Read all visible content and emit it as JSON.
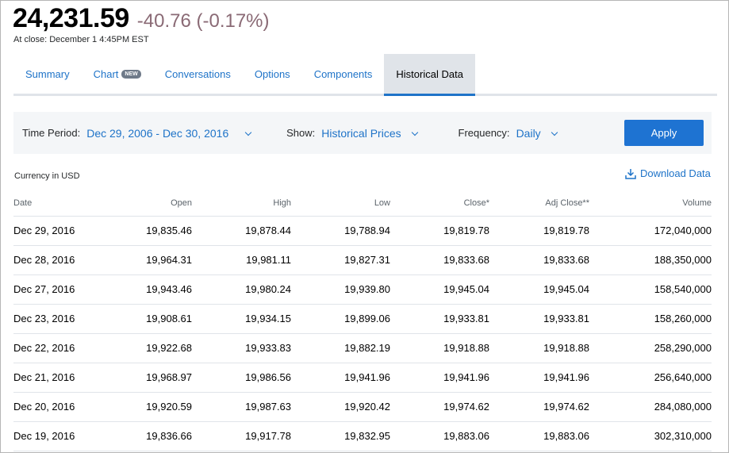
{
  "quote": {
    "price": "24,231.59",
    "change": "-40.76 (-0.17%)",
    "at_close": "At close: December 1 4:45PM EST"
  },
  "tabs": [
    {
      "label": "Summary",
      "badge": ""
    },
    {
      "label": "Chart",
      "badge": "NEW"
    },
    {
      "label": "Conversations",
      "badge": ""
    },
    {
      "label": "Options",
      "badge": ""
    },
    {
      "label": "Components",
      "badge": ""
    },
    {
      "label": "Historical Data",
      "badge": "",
      "active": true
    }
  ],
  "filters": {
    "time_period_label": "Time Period:",
    "time_period_value": "Dec 29, 2006 - Dec 30, 2016",
    "show_label": "Show:",
    "show_value": "Historical Prices",
    "frequency_label": "Frequency:",
    "frequency_value": "Daily",
    "apply_label": "Apply"
  },
  "currency": "Currency in USD",
  "download_label": "Download Data",
  "table": {
    "headers": [
      "Date",
      "Open",
      "High",
      "Low",
      "Close*",
      "Adj Close**",
      "Volume"
    ],
    "rows": [
      [
        "Dec 29, 2016",
        "19,835.46",
        "19,878.44",
        "19,788.94",
        "19,819.78",
        "19,819.78",
        "172,040,000"
      ],
      [
        "Dec 28, 2016",
        "19,964.31",
        "19,981.11",
        "19,827.31",
        "19,833.68",
        "19,833.68",
        "188,350,000"
      ],
      [
        "Dec 27, 2016",
        "19,943.46",
        "19,980.24",
        "19,939.80",
        "19,945.04",
        "19,945.04",
        "158,540,000"
      ],
      [
        "Dec 23, 2016",
        "19,908.61",
        "19,934.15",
        "19,899.06",
        "19,933.81",
        "19,933.81",
        "158,260,000"
      ],
      [
        "Dec 22, 2016",
        "19,922.68",
        "19,933.83",
        "19,882.19",
        "19,918.88",
        "19,918.88",
        "258,290,000"
      ],
      [
        "Dec 21, 2016",
        "19,968.97",
        "19,986.56",
        "19,941.96",
        "19,941.96",
        "19,941.96",
        "256,640,000"
      ],
      [
        "Dec 20, 2016",
        "19,920.59",
        "19,987.63",
        "19,920.42",
        "19,974.62",
        "19,974.62",
        "284,080,000"
      ],
      [
        "Dec 19, 2016",
        "19,836.66",
        "19,917.78",
        "19,832.95",
        "19,883.06",
        "19,883.06",
        "302,310,000"
      ]
    ]
  },
  "colors": {
    "accent": "#1e73c8",
    "negative_change": "#8a6a75",
    "tab_active_bg": "#e0e4e9",
    "filter_bar_bg": "#f4f6f8"
  },
  "icons": {
    "dropdown": "chevron-down-icon",
    "download": "download-icon"
  }
}
